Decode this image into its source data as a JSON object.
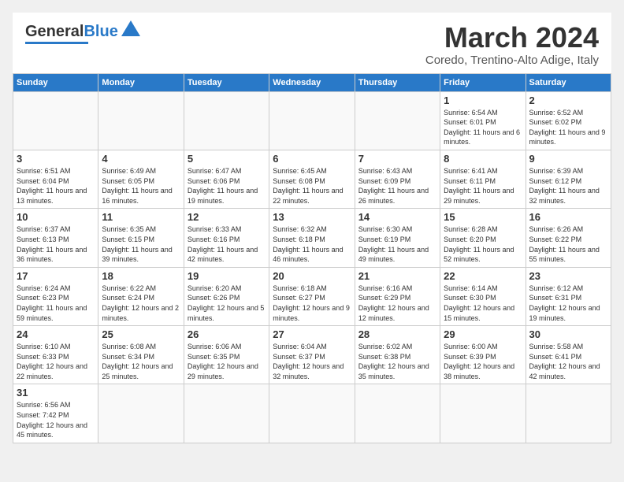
{
  "header": {
    "logo_text_general": "General",
    "logo_text_blue": "Blue",
    "month_title": "March 2024",
    "subtitle": "Coredo, Trentino-Alto Adige, Italy"
  },
  "weekdays": [
    "Sunday",
    "Monday",
    "Tuesday",
    "Wednesday",
    "Thursday",
    "Friday",
    "Saturday"
  ],
  "weeks": [
    [
      {
        "day": "",
        "info": ""
      },
      {
        "day": "",
        "info": ""
      },
      {
        "day": "",
        "info": ""
      },
      {
        "day": "",
        "info": ""
      },
      {
        "day": "",
        "info": ""
      },
      {
        "day": "1",
        "info": "Sunrise: 6:54 AM\nSunset: 6:01 PM\nDaylight: 11 hours and 6 minutes."
      },
      {
        "day": "2",
        "info": "Sunrise: 6:52 AM\nSunset: 6:02 PM\nDaylight: 11 hours and 9 minutes."
      }
    ],
    [
      {
        "day": "3",
        "info": "Sunrise: 6:51 AM\nSunset: 6:04 PM\nDaylight: 11 hours and 13 minutes."
      },
      {
        "day": "4",
        "info": "Sunrise: 6:49 AM\nSunset: 6:05 PM\nDaylight: 11 hours and 16 minutes."
      },
      {
        "day": "5",
        "info": "Sunrise: 6:47 AM\nSunset: 6:06 PM\nDaylight: 11 hours and 19 minutes."
      },
      {
        "day": "6",
        "info": "Sunrise: 6:45 AM\nSunset: 6:08 PM\nDaylight: 11 hours and 22 minutes."
      },
      {
        "day": "7",
        "info": "Sunrise: 6:43 AM\nSunset: 6:09 PM\nDaylight: 11 hours and 26 minutes."
      },
      {
        "day": "8",
        "info": "Sunrise: 6:41 AM\nSunset: 6:11 PM\nDaylight: 11 hours and 29 minutes."
      },
      {
        "day": "9",
        "info": "Sunrise: 6:39 AM\nSunset: 6:12 PM\nDaylight: 11 hours and 32 minutes."
      }
    ],
    [
      {
        "day": "10",
        "info": "Sunrise: 6:37 AM\nSunset: 6:13 PM\nDaylight: 11 hours and 36 minutes."
      },
      {
        "day": "11",
        "info": "Sunrise: 6:35 AM\nSunset: 6:15 PM\nDaylight: 11 hours and 39 minutes."
      },
      {
        "day": "12",
        "info": "Sunrise: 6:33 AM\nSunset: 6:16 PM\nDaylight: 11 hours and 42 minutes."
      },
      {
        "day": "13",
        "info": "Sunrise: 6:32 AM\nSunset: 6:18 PM\nDaylight: 11 hours and 46 minutes."
      },
      {
        "day": "14",
        "info": "Sunrise: 6:30 AM\nSunset: 6:19 PM\nDaylight: 11 hours and 49 minutes."
      },
      {
        "day": "15",
        "info": "Sunrise: 6:28 AM\nSunset: 6:20 PM\nDaylight: 11 hours and 52 minutes."
      },
      {
        "day": "16",
        "info": "Sunrise: 6:26 AM\nSunset: 6:22 PM\nDaylight: 11 hours and 55 minutes."
      }
    ],
    [
      {
        "day": "17",
        "info": "Sunrise: 6:24 AM\nSunset: 6:23 PM\nDaylight: 11 hours and 59 minutes."
      },
      {
        "day": "18",
        "info": "Sunrise: 6:22 AM\nSunset: 6:24 PM\nDaylight: 12 hours and 2 minutes."
      },
      {
        "day": "19",
        "info": "Sunrise: 6:20 AM\nSunset: 6:26 PM\nDaylight: 12 hours and 5 minutes."
      },
      {
        "day": "20",
        "info": "Sunrise: 6:18 AM\nSunset: 6:27 PM\nDaylight: 12 hours and 9 minutes."
      },
      {
        "day": "21",
        "info": "Sunrise: 6:16 AM\nSunset: 6:29 PM\nDaylight: 12 hours and 12 minutes."
      },
      {
        "day": "22",
        "info": "Sunrise: 6:14 AM\nSunset: 6:30 PM\nDaylight: 12 hours and 15 minutes."
      },
      {
        "day": "23",
        "info": "Sunrise: 6:12 AM\nSunset: 6:31 PM\nDaylight: 12 hours and 19 minutes."
      }
    ],
    [
      {
        "day": "24",
        "info": "Sunrise: 6:10 AM\nSunset: 6:33 PM\nDaylight: 12 hours and 22 minutes."
      },
      {
        "day": "25",
        "info": "Sunrise: 6:08 AM\nSunset: 6:34 PM\nDaylight: 12 hours and 25 minutes."
      },
      {
        "day": "26",
        "info": "Sunrise: 6:06 AM\nSunset: 6:35 PM\nDaylight: 12 hours and 29 minutes."
      },
      {
        "day": "27",
        "info": "Sunrise: 6:04 AM\nSunset: 6:37 PM\nDaylight: 12 hours and 32 minutes."
      },
      {
        "day": "28",
        "info": "Sunrise: 6:02 AM\nSunset: 6:38 PM\nDaylight: 12 hours and 35 minutes."
      },
      {
        "day": "29",
        "info": "Sunrise: 6:00 AM\nSunset: 6:39 PM\nDaylight: 12 hours and 38 minutes."
      },
      {
        "day": "30",
        "info": "Sunrise: 5:58 AM\nSunset: 6:41 PM\nDaylight: 12 hours and 42 minutes."
      }
    ],
    [
      {
        "day": "31",
        "info": "Sunrise: 6:56 AM\nSunset: 7:42 PM\nDaylight: 12 hours and 45 minutes."
      },
      {
        "day": "",
        "info": ""
      },
      {
        "day": "",
        "info": ""
      },
      {
        "day": "",
        "info": ""
      },
      {
        "day": "",
        "info": ""
      },
      {
        "day": "",
        "info": ""
      },
      {
        "day": "",
        "info": ""
      }
    ]
  ]
}
